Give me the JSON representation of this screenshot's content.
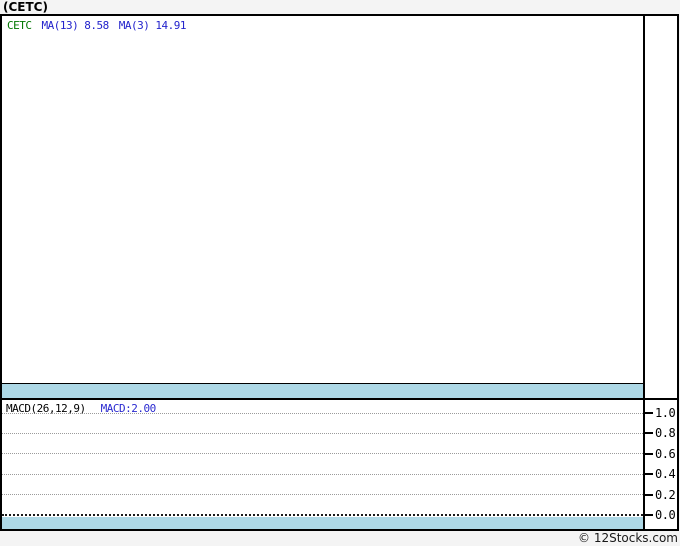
{
  "page": {
    "copyright": "© 12Stocks.com",
    "background_color": "#f4f4f4"
  },
  "header": {
    "title": "(CETC)"
  },
  "main_panel": {
    "legend": {
      "symbol": "CETC",
      "ma13_label": "MA(13)",
      "ma13_value": "8.58",
      "ma3_label": "MA(3)",
      "ma3_value": "14.91"
    }
  },
  "macd_panel": {
    "legend_label": "MACD(26,12,9)",
    "legend_value": "MACD:2.00",
    "axis_ticks": [
      "1.0",
      "0.8",
      "0.6",
      "0.4",
      "0.2",
      "0.0"
    ]
  },
  "colors": {
    "band_blue": "#add8e6",
    "legend_blue": "#2323cc",
    "symbol_green": "#007700",
    "gridline_gray": "#9b9b9b",
    "border_black": "#000000",
    "chart_background": "#ffffff"
  },
  "chart_data": {
    "type": "line",
    "title": "(CETC)",
    "panels": [
      {
        "name": "price",
        "legend": [
          "CETC",
          "MA(13) 8.58",
          "MA(3) 14.91"
        ],
        "series": [
          {
            "name": "CETC",
            "values": []
          },
          {
            "name": "MA(13)",
            "last_value": 8.58,
            "values": []
          },
          {
            "name": "MA(3)",
            "last_value": 14.91,
            "values": []
          }
        ],
        "data_visible": false,
        "grid": false
      },
      {
        "name": "MACD(26,12,9)",
        "legend": [
          "MACD(26,12,9)",
          "MACD:2.00"
        ],
        "series": [
          {
            "name": "MACD",
            "last_value": 2.0,
            "values": []
          }
        ],
        "ylim": [
          0.0,
          1.0
        ],
        "yticks": [
          1.0,
          0.8,
          0.6,
          0.4,
          0.2,
          0.0
        ],
        "grid": true,
        "gridstyle": "dotted",
        "data_visible": false
      }
    ],
    "x": [],
    "xlabel": "",
    "ylabel": "",
    "legend_position": "top-left",
    "source": "12Stocks.com"
  }
}
